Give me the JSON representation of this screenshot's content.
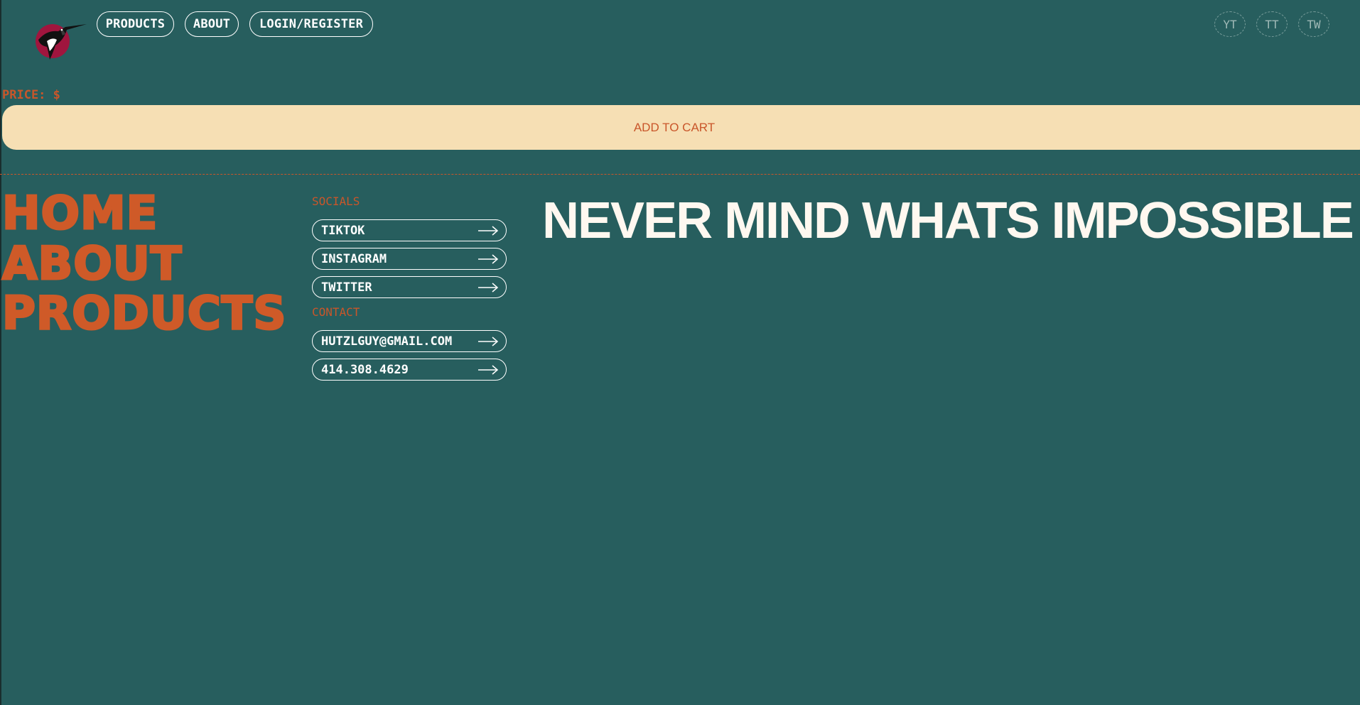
{
  "header": {
    "nav": [
      {
        "label": "PRODUCTS"
      },
      {
        "label": "ABOUT"
      },
      {
        "label": "LOGIN/REGISTER"
      }
    ],
    "socials": [
      {
        "label": "YT"
      },
      {
        "label": "TT"
      },
      {
        "label": "TW"
      }
    ]
  },
  "product": {
    "price_label": "PRICE: $",
    "add_to_cart_label": "ADD TO CART"
  },
  "footer": {
    "big_links": [
      {
        "label": "HOME"
      },
      {
        "label": "ABOUT"
      },
      {
        "label": "PRODUCTS"
      }
    ],
    "socials_heading": "SOCIALS",
    "social_links": [
      {
        "label": "TIKTOK"
      },
      {
        "label": "INSTAGRAM"
      },
      {
        "label": "TWITTER"
      }
    ],
    "contact_heading": "CONTACT",
    "contact_links": [
      {
        "label": "HUTZLGUY@GMAIL.COM"
      },
      {
        "label": "414.308.4629"
      }
    ],
    "tagline": "NEVER MIND WHATS IMPOSSIBLE"
  },
  "colors": {
    "background": "#275e5e",
    "accent": "#cf5a28",
    "button_fill": "#f6dfb4",
    "text": "#ffffff"
  },
  "icons": {
    "logo": "hummingbird-logo",
    "link_arrow": "arrow-right-icon"
  }
}
